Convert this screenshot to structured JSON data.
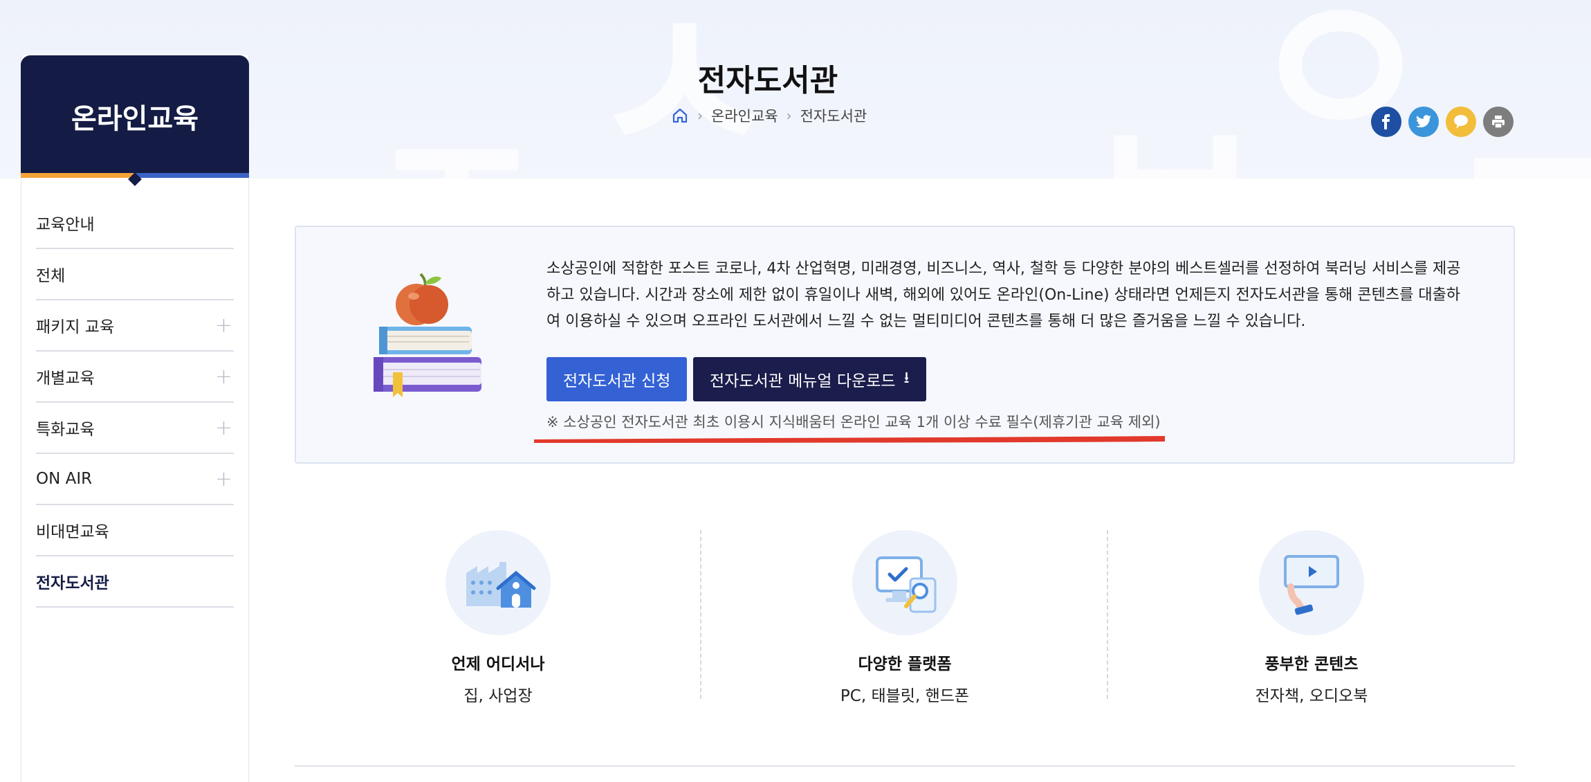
{
  "header": {
    "page_title": "전자도서관",
    "watermark_glyphs": [
      "ㅈ",
      "ㅅ",
      "ㅂ",
      "ㅇ",
      "ㄷ"
    ],
    "breadcrumb": [
      "온라인교육",
      "전자도서관"
    ]
  },
  "share": {
    "icons": [
      "facebook-icon",
      "twitter-icon",
      "kakaotalk-icon",
      "print-icon"
    ],
    "colors": {
      "facebook": "#1e4fa3",
      "twitter": "#3b95db",
      "kakaotalk": "#f2bd3b",
      "print": "#7d7d7d"
    }
  },
  "sidebar": {
    "title": "온라인교육",
    "items": [
      {
        "label": "교육안내",
        "expandable": false,
        "active": false
      },
      {
        "label": "전체",
        "expandable": false,
        "active": false
      },
      {
        "label": "패키지 교육",
        "expandable": true,
        "active": false
      },
      {
        "label": "개별교육",
        "expandable": true,
        "active": false
      },
      {
        "label": "특화교육",
        "expandable": true,
        "active": false
      },
      {
        "label": "ON AIR",
        "expandable": true,
        "active": false
      },
      {
        "label": "비대면교육",
        "expandable": false,
        "active": false
      },
      {
        "label": "전자도서관",
        "expandable": false,
        "active": true
      }
    ],
    "expand_symbol": "+"
  },
  "intro": {
    "description": "소상공인에 적합한 포스트 코로나, 4차 산업혁명, 미래경영, 비즈니스, 역사, 철학 등 다양한 분야의 베스트셀러를 선정하여 북러닝 서비스를 제공하고 있습니다. 시간과 장소에 제한 없이 휴일이나 새벽, 해외에 있어도 온라인(On-Line) 상태라면 언제든지 전자도서관을 통해 콘텐츠를 대출하여 이용하실 수 있으며 오프라인 도서관에서 느낄 수 없는 멀티미디어 콘텐츠를 통해 더 많은 즐거움을 느낄 수 있습니다.",
    "apply_button": "전자도서관 신청",
    "manual_button": "전자도서관 메뉴얼 다운로드",
    "download_arrow": "⭳",
    "note": "※ 소상공인 전자도서관 최초 이용시 지식배움터 온라인 교육 1개 이상 수료 필수(제휴기관 교육 제외)"
  },
  "features": [
    {
      "title": "언제 어디서나",
      "subtitle": "집, 사업장",
      "icon": "factory-home-icon"
    },
    {
      "title": "다양한 플랫폼",
      "subtitle": "PC, 태블릿, 핸드폰",
      "icon": "monitor-search-icon"
    },
    {
      "title": "풍부한 콘텐츠",
      "subtitle": "전자책, 오디오북",
      "icon": "video-screen-icon"
    }
  ],
  "colors": {
    "brand_navy": "#141c45",
    "accent_orange": "#f4a23a",
    "accent_blue": "#3a63c5",
    "apply_button_bg": "#3462d5",
    "manual_button_bg": "#1b1d4c",
    "highlight_red": "#e1392b"
  }
}
